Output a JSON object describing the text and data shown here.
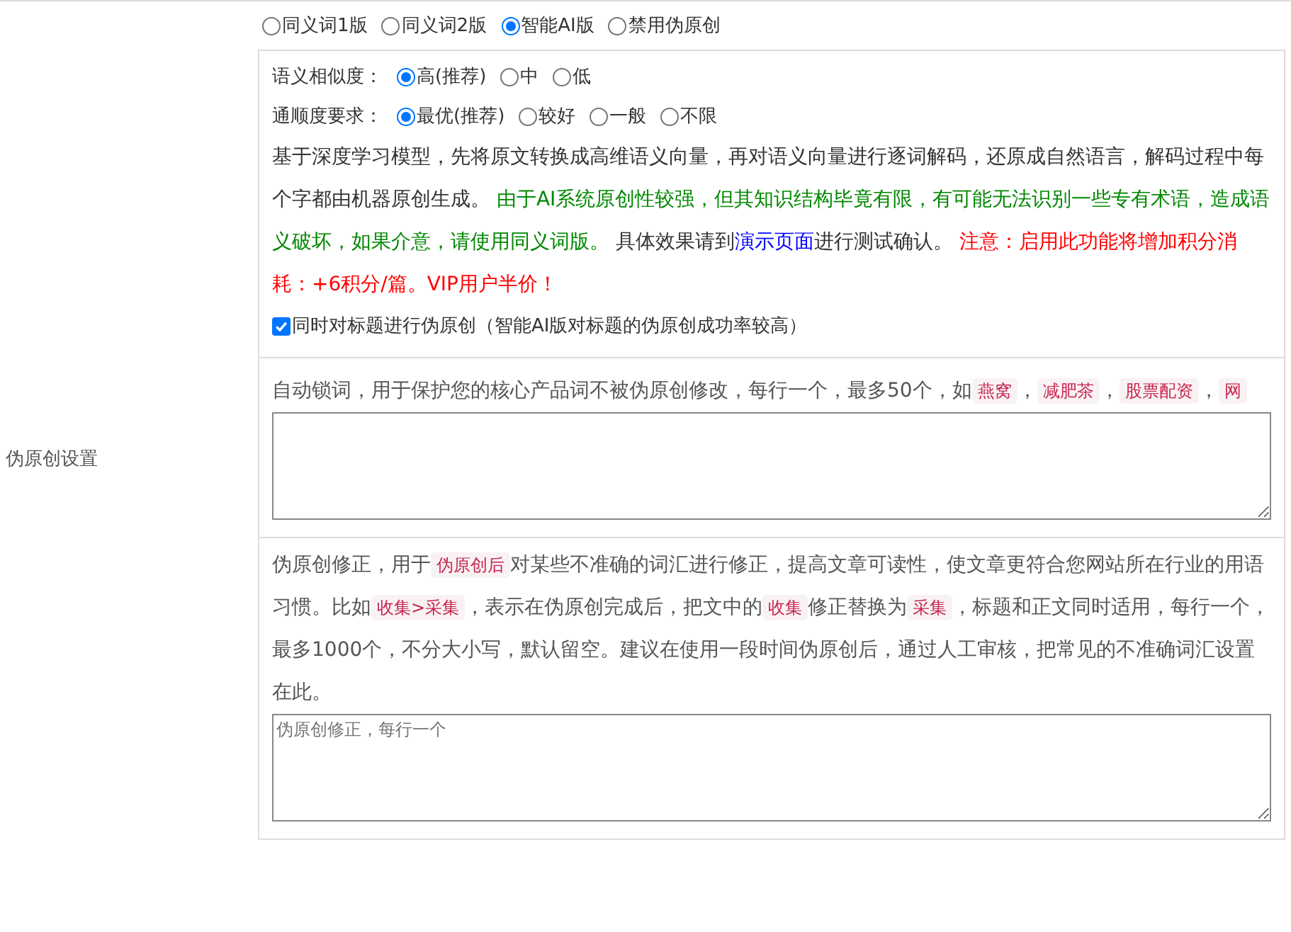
{
  "label": "伪原创设置",
  "modes": [
    {
      "label": "同义词1版",
      "selected": false
    },
    {
      "label": "同义词2版",
      "selected": false
    },
    {
      "label": "智能AI版",
      "selected": true
    },
    {
      "label": "禁用伪原创",
      "selected": false
    }
  ],
  "ai_settings": [
    {
      "label": "语义相似度：",
      "options": [
        {
          "label": "高(推荐)",
          "selected": true
        },
        {
          "label": "中",
          "selected": false
        },
        {
          "label": "低",
          "selected": false
        }
      ]
    },
    {
      "label": "通顺度要求：",
      "options": [
        {
          "label": "最优(推荐)",
          "selected": true
        },
        {
          "label": "较好",
          "selected": false
        },
        {
          "label": "一般",
          "selected": false
        },
        {
          "label": "不限",
          "selected": false
        }
      ]
    }
  ],
  "description": [
    {
      "kind": "text",
      "text": "基于深度学习模型，先将原文转换成高维语义向量，再对语义向量进行逐词解码，还原成自然语言，解码过程中每个字都由机器原创生成。 "
    },
    {
      "kind": "green",
      "text": "由于AI系统原创性较强，但其知识结构毕竟有限，有可能无法识别一些专有术语，造成语义破坏，如果介意，请使用同义词版。"
    },
    {
      "kind": "text",
      "text": " 具体效果请到"
    },
    {
      "kind": "link",
      "text": "演示页面"
    },
    {
      "kind": "text",
      "text": "进行测试确认。 "
    },
    {
      "kind": "red",
      "text": "注意：启用此功能将增加积分消耗：+6积分/篇。VIP用户半价！"
    }
  ],
  "title_checkbox": {
    "label": "同时对标题进行伪原创（智能AI版对标题的伪原创成功率较高）",
    "checked": true
  },
  "lock_words": {
    "description": [
      {
        "kind": "text",
        "text": "自动锁词，用于保护您的核心产品词不被伪原创修改，每行一个，最多50个，如"
      },
      {
        "kind": "code",
        "text": "燕窝"
      },
      {
        "kind": "text",
        "text": "，"
      },
      {
        "kind": "code",
        "text": "减肥茶"
      },
      {
        "kind": "text",
        "text": "，"
      },
      {
        "kind": "code",
        "text": "股票配资"
      },
      {
        "kind": "text",
        "text": "，"
      },
      {
        "kind": "code",
        "text": "网"
      }
    ]
  },
  "corrections": {
    "description": [
      {
        "kind": "text",
        "text": "伪原创修正，用于"
      },
      {
        "kind": "code",
        "text": "伪原创后"
      },
      {
        "kind": "text",
        "text": "对某些不准确的词汇进行修正，提高文章可读性，使文章更符合您网站所在行业的用语习惯。比如"
      },
      {
        "kind": "code",
        "text": "收集>采集"
      },
      {
        "kind": "text",
        "text": "，表示在伪原创完成后，把文中的"
      },
      {
        "kind": "code",
        "text": "收集"
      },
      {
        "kind": "text",
        "text": "修正替换为"
      },
      {
        "kind": "code",
        "text": "采集"
      },
      {
        "kind": "text",
        "text": "，标题和正文同时适用，每行一个，最多1000个，不分大小写，默认留空。建议在使用一段时间伪原创后，通过人工审核，把常见的不准确词汇设置在此。"
      }
    ],
    "placeholder": "伪原创修正，每行一个"
  }
}
